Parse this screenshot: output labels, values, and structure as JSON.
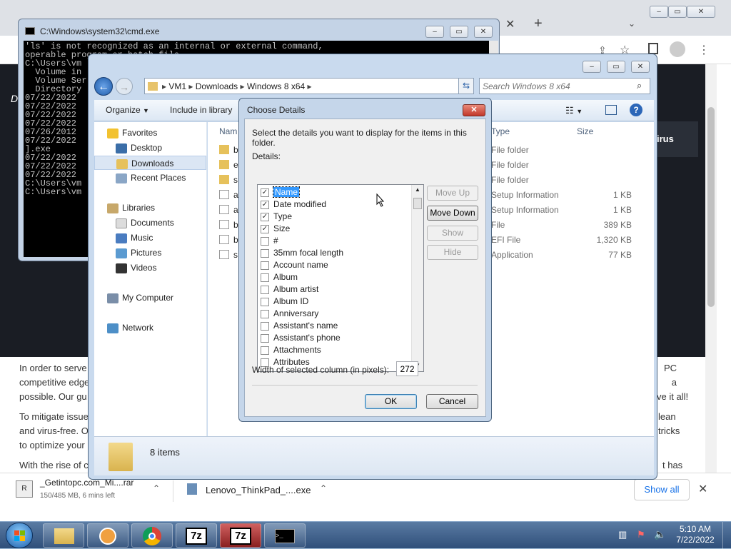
{
  "chrome": {
    "new_tab": "+",
    "show_all": "Show all",
    "downloads": [
      {
        "name": "_Getintopc.com_Mi....rar",
        "detail": "150/485 MB, 6 mins left"
      },
      {
        "name": "Lenovo_ThinkPad_....exe"
      }
    ],
    "page": {
      "dark_text": "D",
      "right_label": "irus",
      "p1a": "In order to serve",
      "p1b": "competitive edge",
      "p1c": "possible. Our gu",
      "p1r1": "PC a",
      "p1r2": "ve it all!",
      "p2a": "To mitigate issue",
      "p2b": "and virus-free. O",
      "p2c": "to optimize your",
      "p2r1": "lean",
      "p2r2": "tricks",
      "p3a": "With the rise of c",
      "p3r": "t has"
    }
  },
  "cmd": {
    "title": "C:\\Windows\\system32\\cmd.exe",
    "lines": [
      "'ls' is not recognized as an internal or external command,",
      "operable program or batch file.",
      "",
      "C:\\Users\\vm",
      "  Volume in",
      "  Volume Ser",
      "",
      "  Directory",
      "",
      "07/22/2022",
      "07/22/2022",
      "07/22/2022",
      "07/22/2022",
      "07/26/2012",
      "07/22/2022",
      "].exe",
      "07/22/2022",
      "07/22/2022",
      "07/22/2022",
      "",
      "",
      "C:\\Users\\vm",
      "",
      "C:\\Users\\vm"
    ]
  },
  "explorer": {
    "breadcrumb": [
      "VM1",
      "Downloads",
      "Windows 8 x64"
    ],
    "search_placeholder": "Search Windows 8 x64",
    "organize": "Organize",
    "include": "Include in library",
    "nav": {
      "favorites": "Favorites",
      "desktop": "Desktop",
      "downloads": "Downloads",
      "recent": "Recent Places",
      "libraries": "Libraries",
      "documents": "Documents",
      "music": "Music",
      "pictures": "Pictures",
      "videos": "Videos",
      "computer": "My Computer",
      "network": "Network"
    },
    "col_name": "Nam",
    "col_type": "Type",
    "col_size": "Size",
    "files": [
      {
        "n": "b",
        "type": "File folder",
        "size": ""
      },
      {
        "n": "e",
        "type": "File folder",
        "size": ""
      },
      {
        "n": "s",
        "type": "File folder",
        "size": ""
      },
      {
        "n": "a",
        "type": "Setup Information",
        "size": "1 KB"
      },
      {
        "n": "a",
        "type": "Setup Information",
        "size": "1 KB"
      },
      {
        "n": "b",
        "type": "File",
        "size": "389 KB"
      },
      {
        "n": "b",
        "type": "EFI File",
        "size": "1,320 KB"
      },
      {
        "n": "s",
        "type": "Application",
        "size": "77 KB"
      }
    ],
    "items_count": "8 items"
  },
  "dialog": {
    "title": "Choose Details",
    "instruction": "Select the details you want to display for the items in this folder.",
    "details_label": "Details:",
    "items": [
      {
        "label": "Name",
        "checked": true,
        "selected": true
      },
      {
        "label": "Date modified",
        "checked": true
      },
      {
        "label": "Type",
        "checked": true
      },
      {
        "label": "Size",
        "checked": true
      },
      {
        "label": "#",
        "checked": false
      },
      {
        "label": "35mm focal length",
        "checked": false
      },
      {
        "label": "Account name",
        "checked": false
      },
      {
        "label": "Album",
        "checked": false
      },
      {
        "label": "Album artist",
        "checked": false
      },
      {
        "label": "Album ID",
        "checked": false
      },
      {
        "label": "Anniversary",
        "checked": false
      },
      {
        "label": "Assistant's name",
        "checked": false
      },
      {
        "label": "Assistant's phone",
        "checked": false
      },
      {
        "label": "Attachments",
        "checked": false
      },
      {
        "label": "Attributes",
        "checked": false
      }
    ],
    "move_up": "Move Up",
    "move_down": "Move Down",
    "show": "Show",
    "hide": "Hide",
    "width_label": "Width of selected column (in pixels):",
    "width_value": "272",
    "ok": "OK",
    "cancel": "Cancel"
  },
  "taskbar": {
    "time": "5:10 AM",
    "date": "7/22/2022",
    "sevenzip": "7z"
  }
}
